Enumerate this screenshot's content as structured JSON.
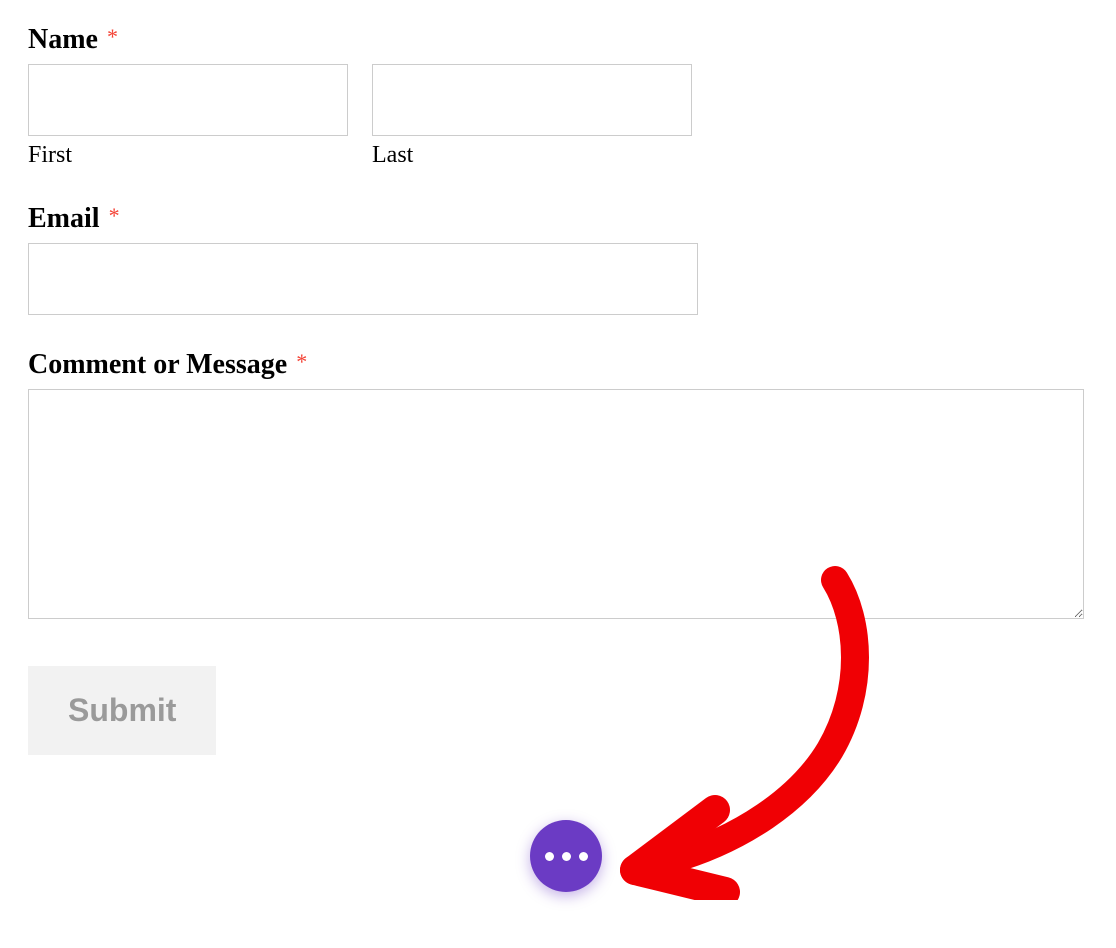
{
  "form": {
    "name": {
      "label": "Name",
      "required_marker": "*",
      "first": {
        "value": "",
        "sublabel": "First"
      },
      "last": {
        "value": "",
        "sublabel": "Last"
      }
    },
    "email": {
      "label": "Email",
      "required_marker": "*",
      "value": ""
    },
    "comment": {
      "label": "Comment or Message",
      "required_marker": "*",
      "value": ""
    },
    "submit": {
      "label": "Submit"
    }
  },
  "chat": {
    "icon": "ellipsis-icon"
  },
  "colors": {
    "required": "#f44336",
    "chat_button": "#6b3bc4",
    "submit_bg": "#f2f2f2",
    "submit_text": "#9a9a9a",
    "annotation": "#f00004"
  }
}
